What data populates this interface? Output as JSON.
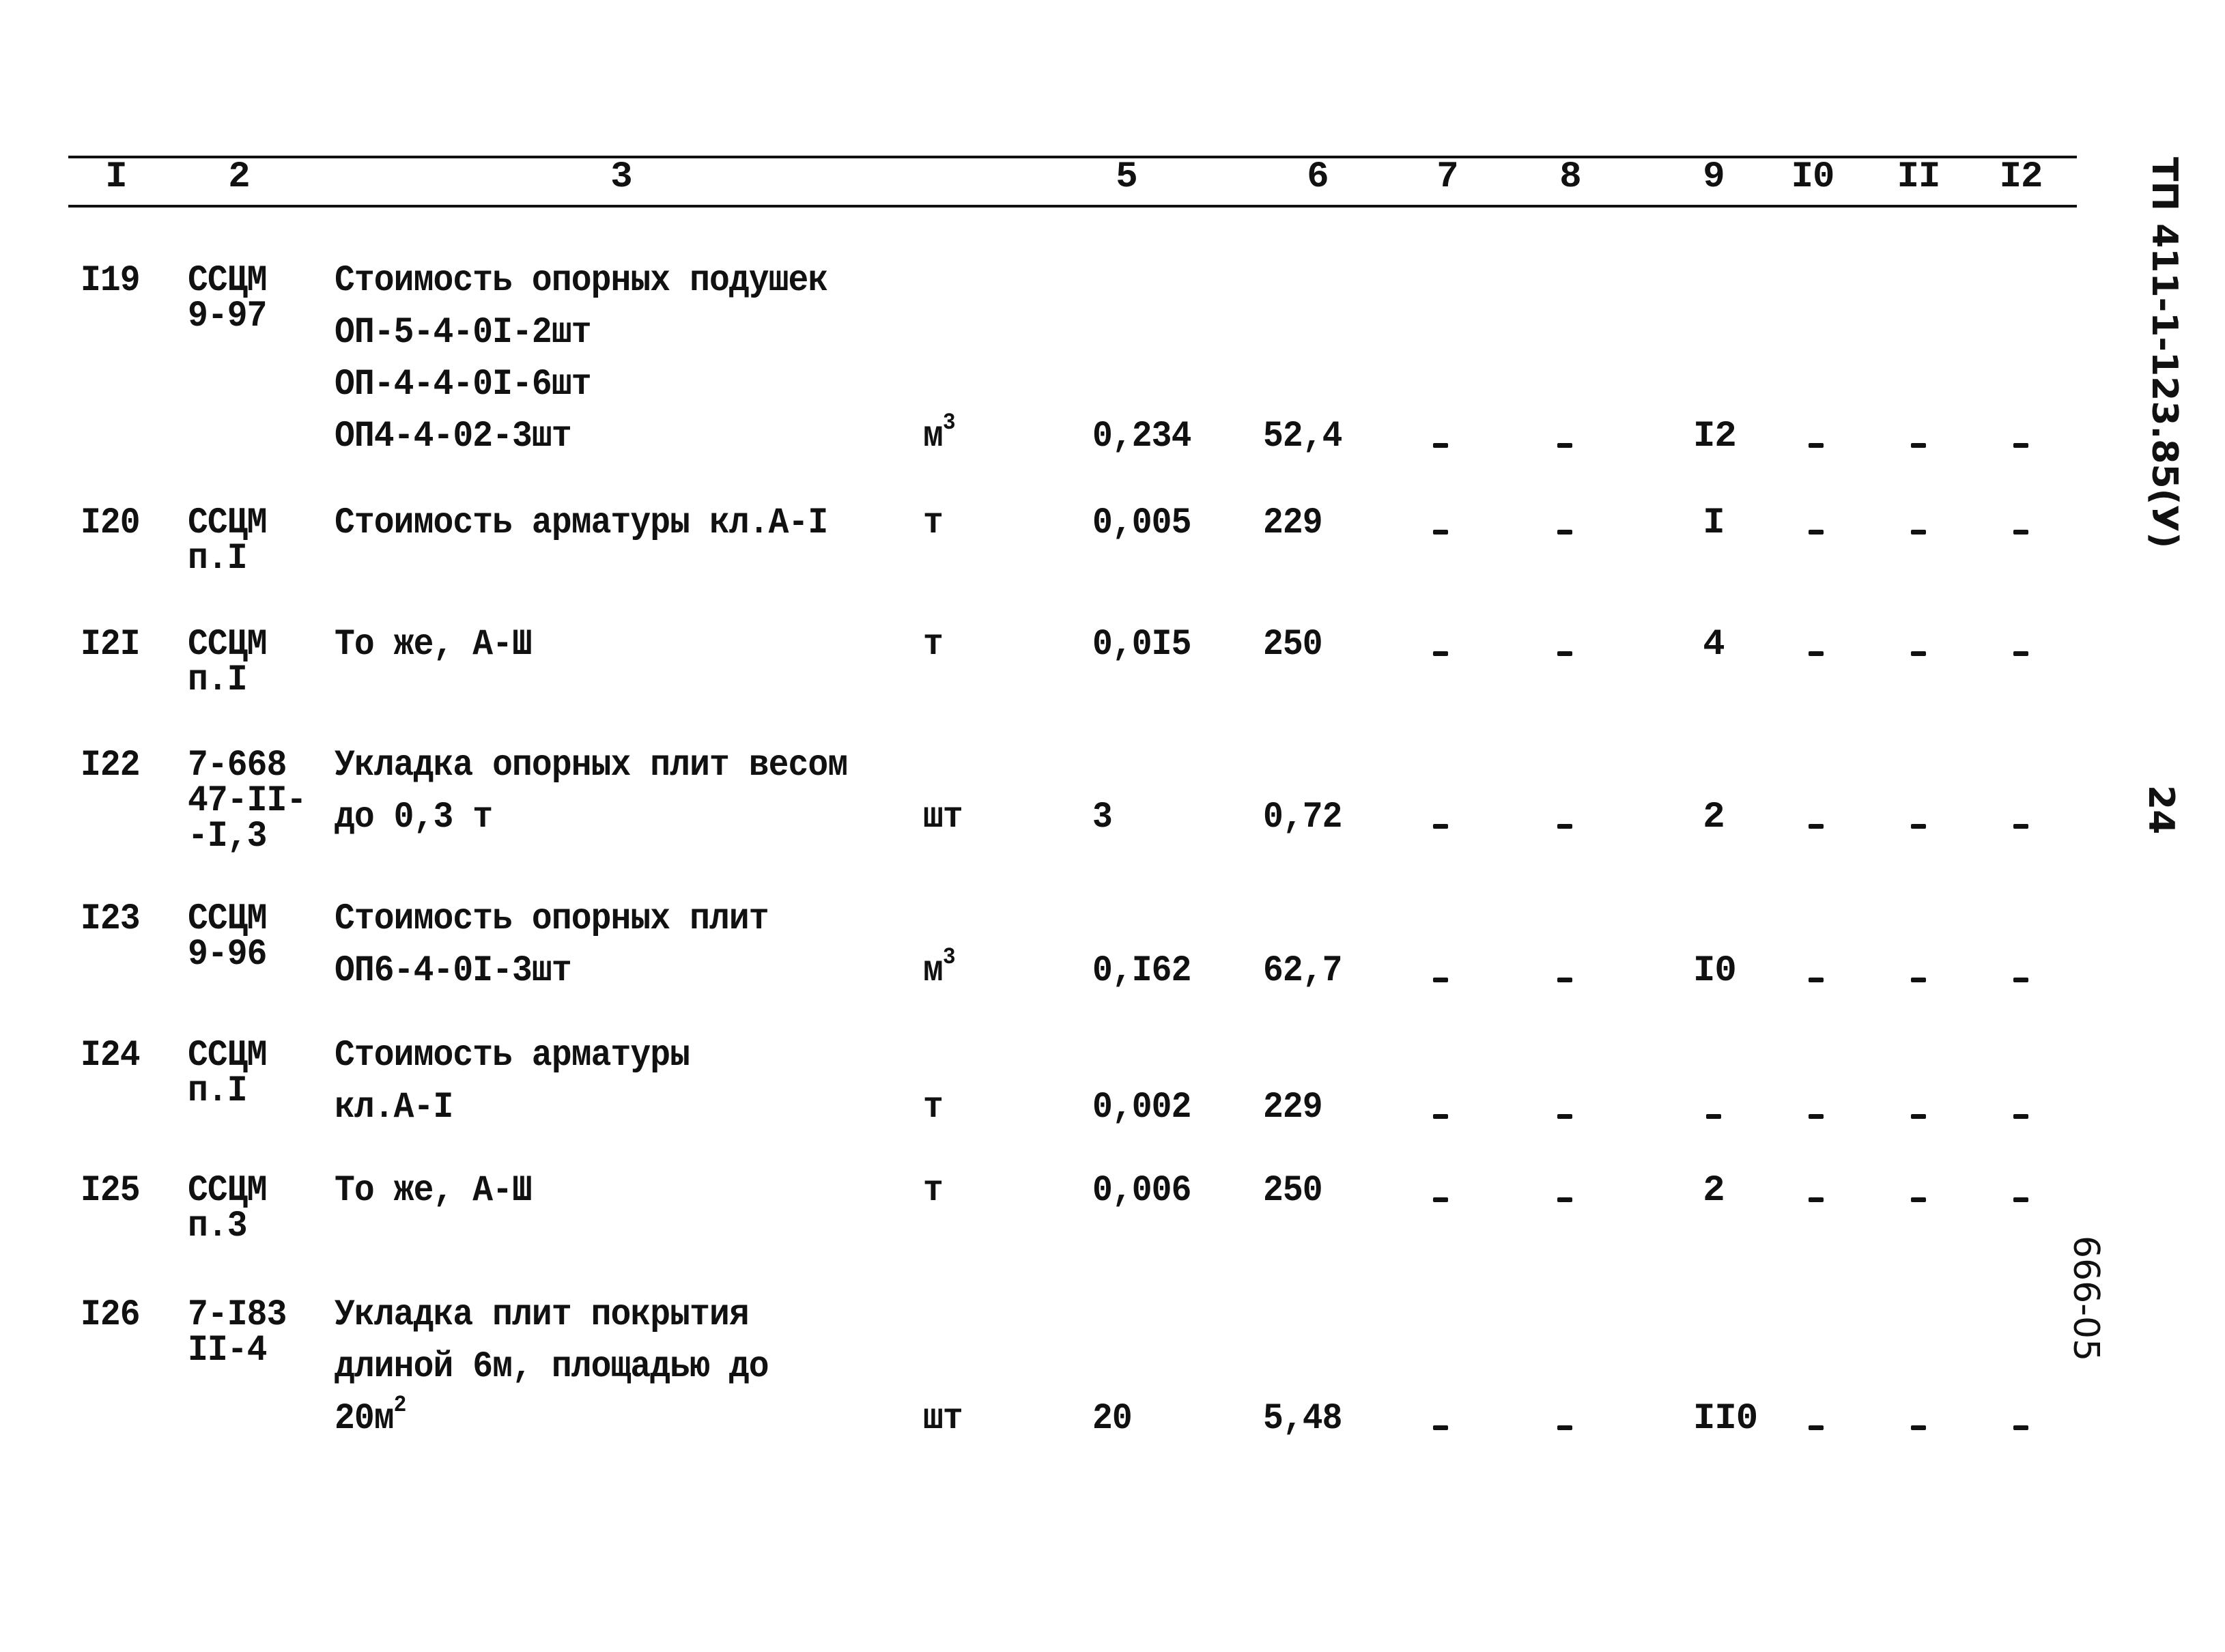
{
  "header": {
    "columns": [
      "I",
      "2",
      "3",
      "5",
      "6",
      "7",
      "8",
      "9",
      "I0",
      "II",
      "I2"
    ]
  },
  "margin": {
    "doc_code": "ТП 411-1-123.85(У)",
    "page_number": "24",
    "sheet_code": "666-05"
  },
  "rows": [
    {
      "num": "I19",
      "ref": [
        "ССЦМ",
        "9-97"
      ],
      "desc": [
        "Стоимость опорных подушек",
        "ОП-5-4-0I-2шт",
        "ОП-4-4-0I-6шт",
        "ОП4-4-02-3шт"
      ],
      "unit": "м",
      "unit_sup": "3",
      "c5": "0,234",
      "c6": "52,4",
      "c7": "-",
      "c8": "-",
      "c9": "I2",
      "c10": "-",
      "c11": "-",
      "c12": "-"
    },
    {
      "num": "I20",
      "ref": [
        "ССЦМ",
        "п.I"
      ],
      "desc": [
        "Стоимость арматуры кл.А-I"
      ],
      "unit": "т",
      "unit_sup": "",
      "c5": "0,005",
      "c6": "229",
      "c7": "-",
      "c8": "-",
      "c9": "I",
      "c10": "-",
      "c11": "-",
      "c12": "-"
    },
    {
      "num": "I2I",
      "ref": [
        "ССЦМ",
        "п.I"
      ],
      "desc": [
        "То же, А-Ш"
      ],
      "unit": "т",
      "unit_sup": "",
      "c5": "0,0I5",
      "c6": "250",
      "c7": "-",
      "c8": "-",
      "c9": "4",
      "c10": "-",
      "c11": "-",
      "c12": "-"
    },
    {
      "num": "I22",
      "ref": [
        "7-668",
        "47-II-",
        "-I,3"
      ],
      "desc": [
        "Укладка опорных плит весом",
        "до 0,3 т"
      ],
      "unit": "шт",
      "unit_sup": "",
      "c5": "3",
      "c6": "0,72",
      "c7": "-",
      "c8": "-",
      "c9": "2",
      "c10": "-",
      "c11": "-",
      "c12": "-"
    },
    {
      "num": "I23",
      "ref": [
        "ССЦМ",
        "9-96"
      ],
      "desc": [
        "Стоимость опорных плит",
        "ОП6-4-0I-3шт"
      ],
      "unit": "м",
      "unit_sup": "3",
      "c5": "0,I62",
      "c6": "62,7",
      "c7": "-",
      "c8": "-",
      "c9": "I0",
      "c10": "-",
      "c11": "-",
      "c12": "-"
    },
    {
      "num": "I24",
      "ref": [
        "ССЦМ",
        "п.I"
      ],
      "desc": [
        "Стоимость арматуры",
        "кл.А-I"
      ],
      "unit": "т",
      "unit_sup": "",
      "c5": "0,002",
      "c6": "229",
      "c7": "-",
      "c8": "-",
      "c9": "-",
      "c10": "-",
      "c11": "-",
      "c12": "-"
    },
    {
      "num": "I25",
      "ref": [
        "ССЦМ",
        "п.3"
      ],
      "desc": [
        "То же, А-Ш"
      ],
      "unit": "т",
      "unit_sup": "",
      "c5": "0,006",
      "c6": "250",
      "c7": "-",
      "c8": "-",
      "c9": "2",
      "c10": "-",
      "c11": "-",
      "c12": "-"
    },
    {
      "num": "I26",
      "ref": [
        "7-I83",
        "II-4"
      ],
      "desc": [
        "Укладка плит покрытия",
        "длиной 6м, площадью до",
        "20м"
      ],
      "desc_last_sup": "2",
      "unit": "шт",
      "unit_sup": "",
      "c5": "20",
      "c6": "5,48",
      "c7": "-",
      "c8": "-",
      "c9": "II0",
      "c10": "-",
      "c11": "-",
      "c12": "-"
    }
  ]
}
